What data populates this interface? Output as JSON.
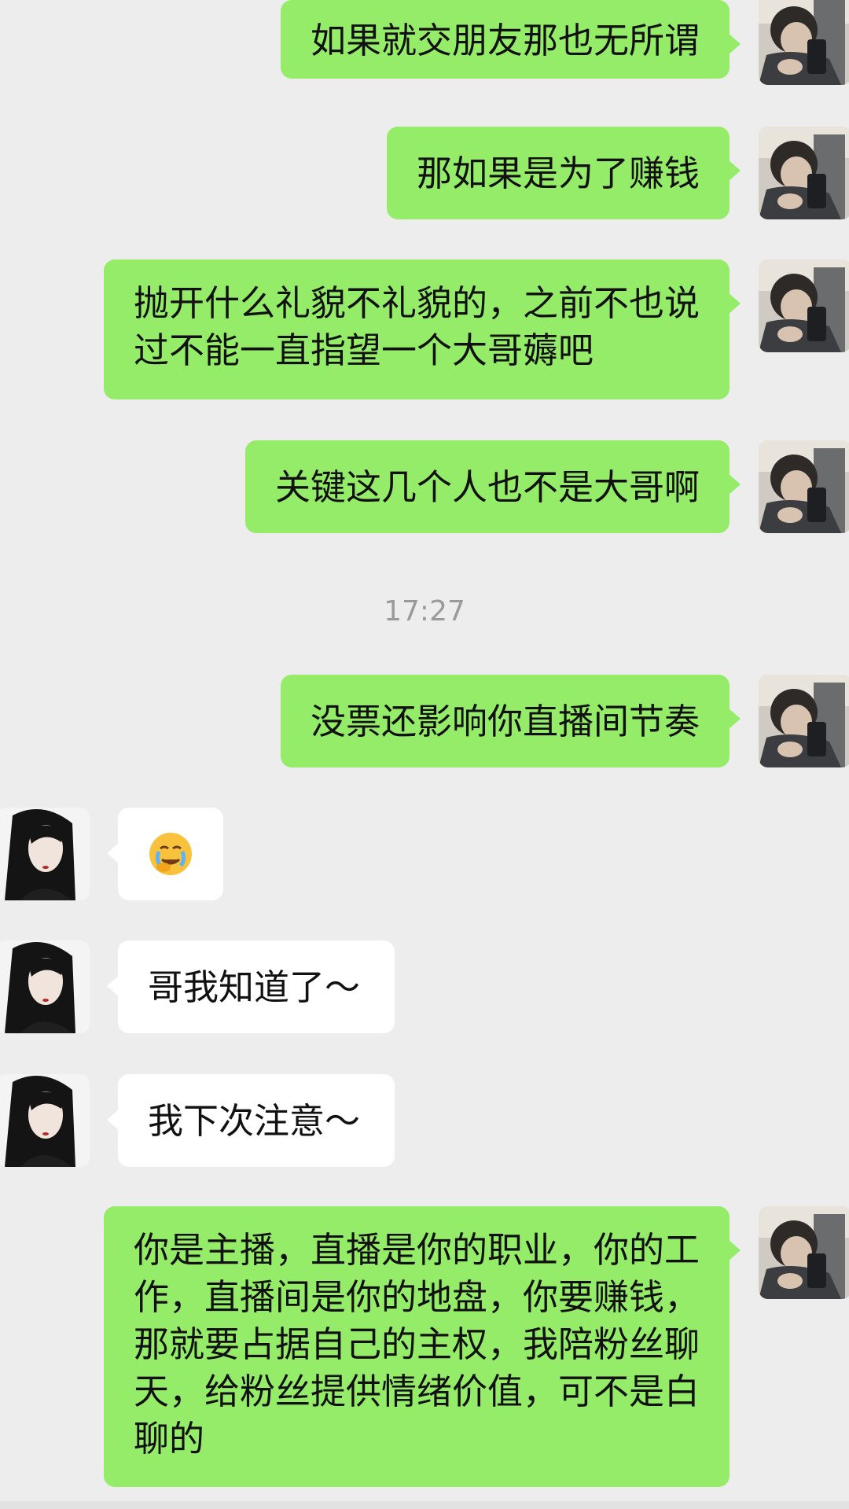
{
  "messages": [
    {
      "sender": "me",
      "text": "如果就交朋友那也无所谓"
    },
    {
      "sender": "me",
      "text": "那如果是为了赚钱"
    },
    {
      "sender": "me",
      "text": "抛开什么礼貌不礼貌的，之前不也说过不能一直指望一个大哥薅吧"
    },
    {
      "sender": "me",
      "text": "关键这几个人也不是大哥啊"
    },
    {
      "sender": "me",
      "text": "没票还影响你直播间节奏"
    },
    {
      "sender": "them",
      "text": "",
      "emoji": "crying-face"
    },
    {
      "sender": "them",
      "text": "哥我知道了～"
    },
    {
      "sender": "them",
      "text": "我下次注意～"
    },
    {
      "sender": "me",
      "text": "你是主播，直播是你的职业，你的工作，直播间是你的地盘，你要赚钱，那就要占据自己的主权，我陪粉丝聊天，给粉丝提供情绪价值，可不是白聊的"
    }
  ],
  "timestamp": "17:27",
  "colors": {
    "background": "#ededed",
    "my_bubble": "#95ec69",
    "their_bubble": "#ffffff",
    "timestamp": "#9a9a9a"
  }
}
